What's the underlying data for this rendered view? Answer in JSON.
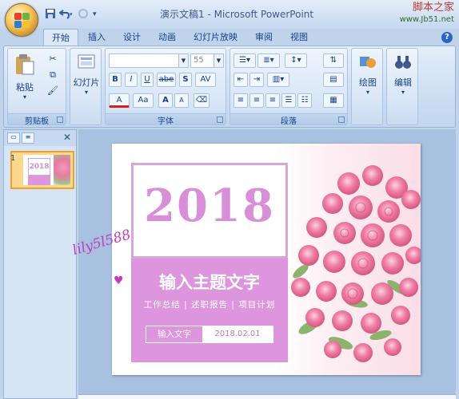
{
  "window": {
    "title": "演示文稿1 - Microsoft PowerPoint",
    "watermark_site": "脚本之家",
    "watermark_url": "www.Jb51.net"
  },
  "ribbon_tabs": [
    "开始",
    "插入",
    "设计",
    "动画",
    "幻灯片放映",
    "审阅",
    "视图"
  ],
  "clipboard": {
    "paste_label": "粘贴",
    "group_label": "剪贴板"
  },
  "slides_group": {
    "label": "幻灯片"
  },
  "font": {
    "group_label": "字体",
    "font_name": "",
    "font_size": "55",
    "buttons": [
      "B",
      "I",
      "U",
      "abe",
      "S",
      "AV",
      "A",
      "Aa",
      "A",
      "A"
    ]
  },
  "paragraph": {
    "group_label": "段落"
  },
  "drawing": {
    "label": "绘图"
  },
  "editing": {
    "label": "编辑"
  },
  "pane": {
    "close_symbol": "✕",
    "slide_number": "1"
  },
  "slide": {
    "year": "2018",
    "main_title": "输入主题文字",
    "subtitle": "工作总结 | 述职报告 | 项目计划",
    "input_label": "输入文字",
    "date": "2018.02.01",
    "signature": "lily5l588"
  },
  "colors": {
    "accent_pink": "#dd95dd",
    "year_pink": "#d98fd8",
    "ribbon_blue": "#15428b"
  }
}
